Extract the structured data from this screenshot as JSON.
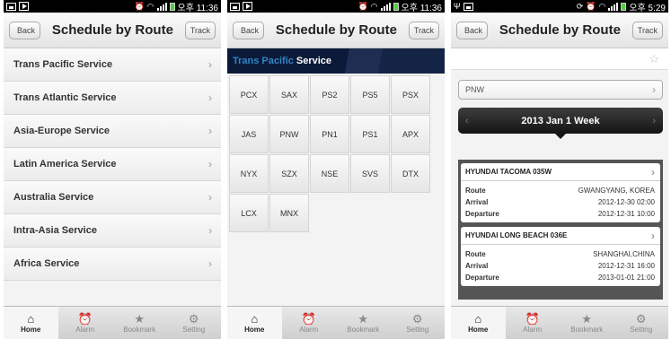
{
  "status_bar": {
    "screen1_time": "오후 11:36",
    "screen2_time": "오후 11:36",
    "screen3_time": "오후 5:29"
  },
  "header": {
    "back_label": "Back",
    "title": "Schedule by Route",
    "track_label": "Track"
  },
  "services": [
    {
      "label": "Trans Pacific Service"
    },
    {
      "label": "Trans Atlantic Service"
    },
    {
      "label": "Asia-Europe Service"
    },
    {
      "label": "Latin America Service"
    },
    {
      "label": "Australia Service"
    },
    {
      "label": "Intra-Asia Service"
    },
    {
      "label": "Africa Service"
    }
  ],
  "route_screen": {
    "banner_part1": "Trans Pacific",
    "banner_part2": "Service",
    "routes": [
      "PCX",
      "SAX",
      "PS2",
      "PS5",
      "PSX",
      "JAS",
      "PNW",
      "PN1",
      "PS1",
      "APX",
      "NYX",
      "SZX",
      "NSE",
      "SVS",
      "DTX",
      "LCX",
      "MNX"
    ]
  },
  "schedule_screen": {
    "route_selected": "PNW",
    "week_label": "2013 Jan 1 Week",
    "row_labels": {
      "route": "Route",
      "arrival": "Arrival",
      "departure": "Departure"
    },
    "vessels": [
      {
        "name": "HYUNDAI TACOMA 035W",
        "route": "GWANGYANG, KOREA",
        "arrival": "2012-12-30  02:00",
        "departure": "2012-12-31  10:00"
      },
      {
        "name": "HYUNDAI LONG BEACH 036E",
        "route": "SHANGHAI,CHINA",
        "arrival": "2012-12-31  16:00",
        "departure": "2013-01-01  21:00"
      }
    ]
  },
  "tabs": [
    {
      "label": "Home",
      "icon": "home-icon"
    },
    {
      "label": "Alarm",
      "icon": "alarm-clock-icon"
    },
    {
      "label": "Bookmark",
      "icon": "star-icon"
    },
    {
      "label": "Setting",
      "icon": "gear-icon"
    }
  ]
}
